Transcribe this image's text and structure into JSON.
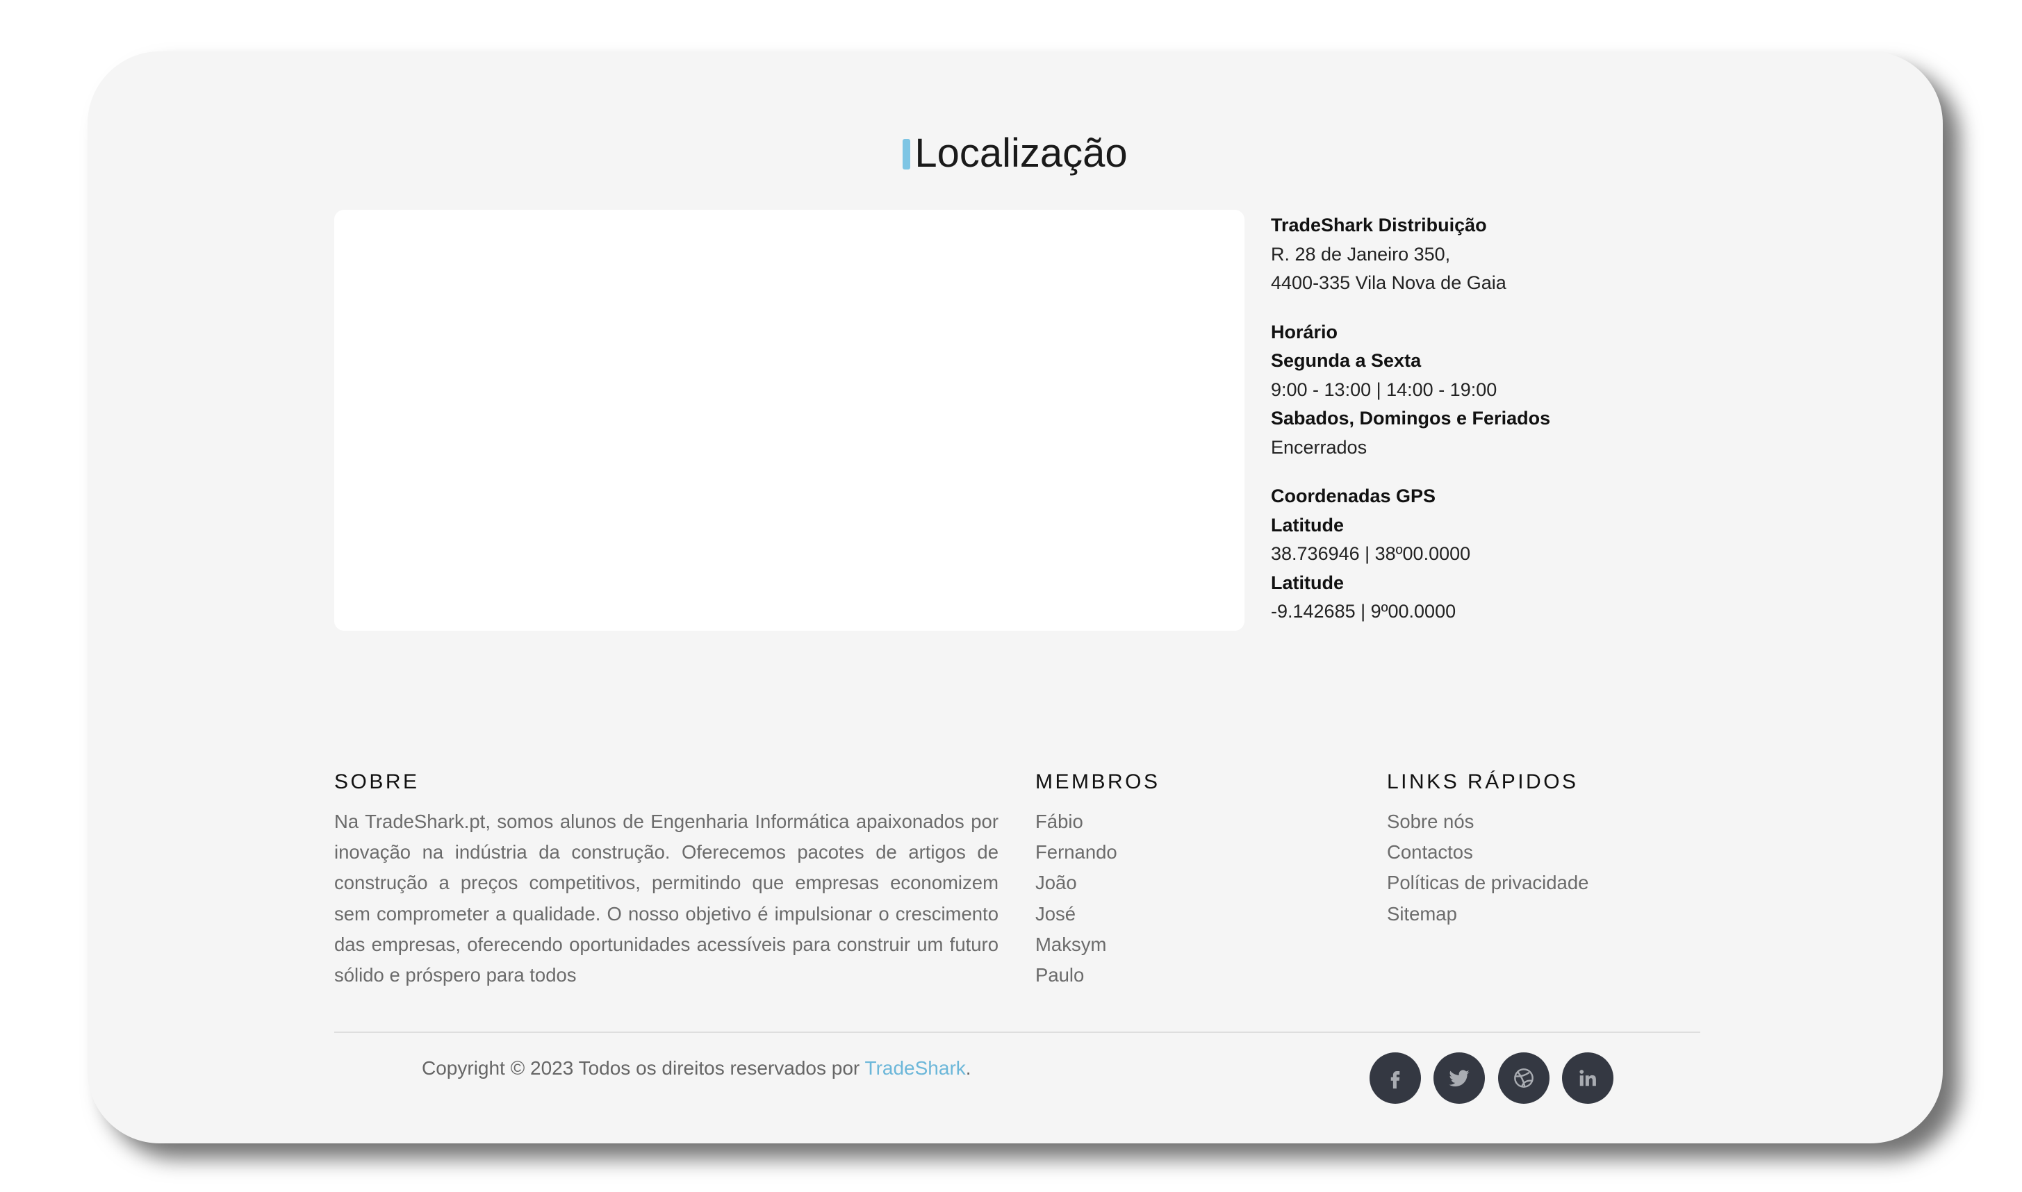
{
  "location": {
    "title": "Localização",
    "company": "TradeShark Distribuição",
    "address_line1": "R. 28 de Janeiro 350,",
    "address_line2": "4400-335 Vila Nova de Gaia",
    "hours_title": "Horário",
    "weekdays_label": "Segunda a Sexta",
    "weekdays_hours": "9:00 - 13:00 | 14:00 - 19:00",
    "weekend_label": "Sabados, Domingos e Feriados",
    "weekend_hours": "Encerrados",
    "gps_title": "Coordenadas GPS",
    "lat_label": "Latitude",
    "lat_value": "38.736946 | 38º00.0000",
    "lon_label": "Latitude",
    "lon_value": "-9.142685 | 9º00.0000"
  },
  "footer": {
    "about": {
      "heading": "SOBRE",
      "text": "Na TradeShark.pt, somos alunos de Engenharia Informática apaixonados por inovação na indústria da construção. Oferecemos pacotes de artigos de construção a preços competitivos, permitindo que empresas economizem sem comprometer a qualidade. O nosso objetivo é impulsionar o crescimento das empresas, oferecendo oportunidades acessíveis para construir um futuro sólido e próspero para todos"
    },
    "members": {
      "heading": "MEMBROS",
      "items": [
        "Fábio",
        "Fernando",
        "João",
        "José",
        "Maksym",
        "Paulo"
      ]
    },
    "links": {
      "heading": "LINKS RÁPIDOS",
      "items": [
        "Sobre nós",
        "Contactos",
        "Políticas de privacidade",
        "Sitemap"
      ]
    },
    "copyright_text": "Copyright © 2023 Todos os direitos reservados por ",
    "copyright_link": "TradeShark",
    "copyright_end": ".",
    "social": [
      "facebook-icon",
      "twitter-icon",
      "dribbble-icon",
      "linkedin-icon"
    ]
  },
  "colors": {
    "accent": "#7ec5e4",
    "link": "#6cb7d9",
    "social_bg": "#343842",
    "card_bg": "#f5f5f5"
  }
}
